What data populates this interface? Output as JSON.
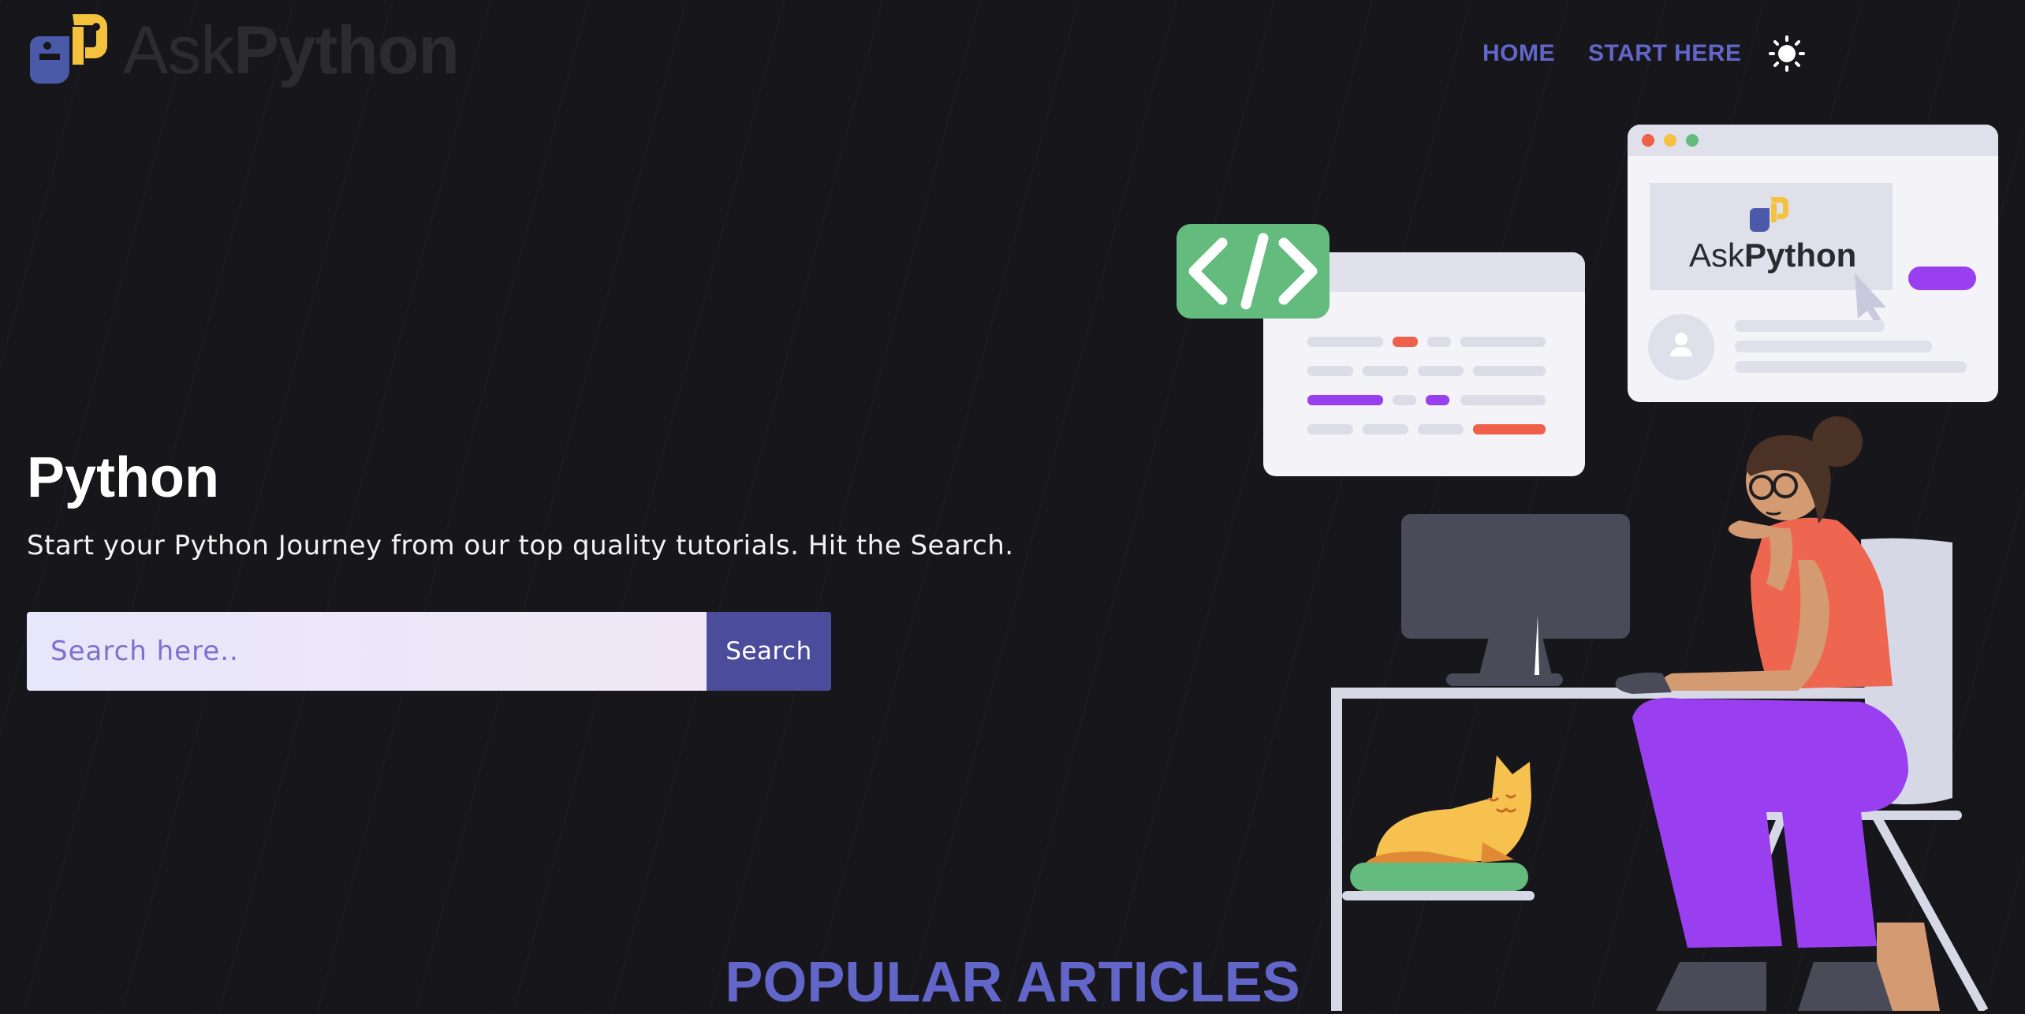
{
  "header": {
    "logo": {
      "text_regular": "Ask",
      "text_bold": "Python"
    },
    "nav": [
      {
        "label": "HOME"
      },
      {
        "label": "START HERE"
      }
    ],
    "theme_toggle_icon": "sun-icon"
  },
  "hero": {
    "title": "Python",
    "subtitle": "Start your Python Journey from our top quality tutorials. Hit the Search.",
    "search": {
      "placeholder": "Search here..",
      "value": "",
      "button_label": "Search"
    }
  },
  "illustration": {
    "browser_logo_regular": "Ask",
    "browser_logo_bold": "Python",
    "code_tag_icon": "code-brackets-icon"
  },
  "popular": {
    "heading": "POPULAR ARTICLES"
  },
  "colors": {
    "background": "#16161b",
    "accent": "#6366c9",
    "button": "#4b4c9b",
    "logo_blue": "#4b5aa8",
    "logo_yellow": "#f4c23d",
    "purple": "#9a3ff0",
    "green": "#63bb7e"
  }
}
